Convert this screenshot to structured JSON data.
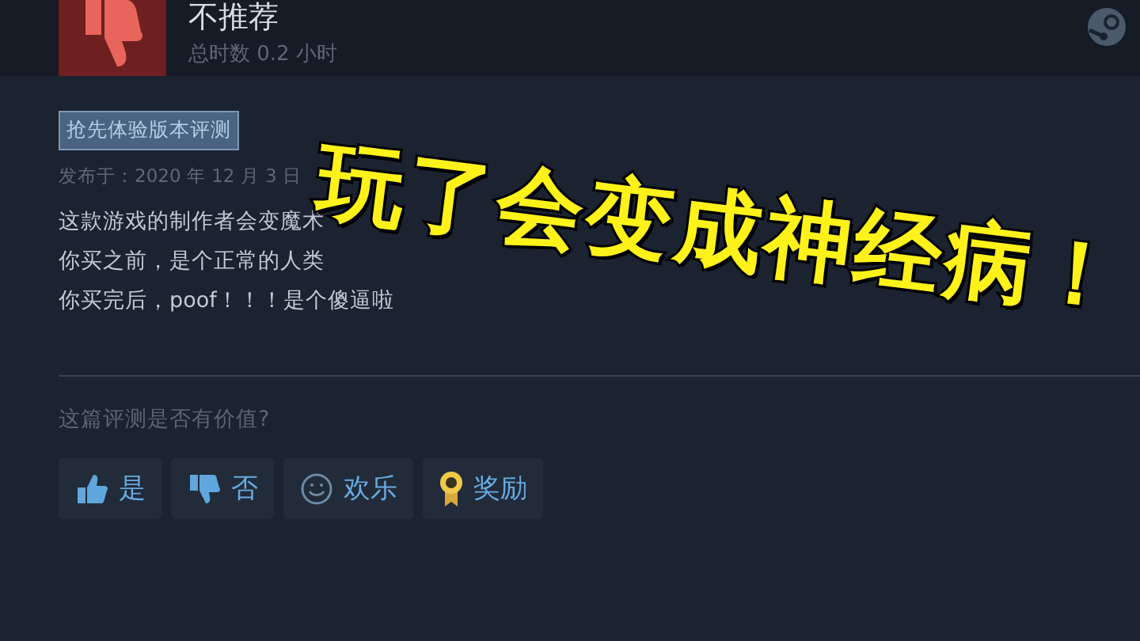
{
  "review": {
    "verdict": "不推荐",
    "hours": "总时数 0.2 小时",
    "badge": "抢先体验版本评测",
    "date": "发布于：2020 年 12 月 3 日",
    "lines": [
      "这款游戏的制作者会变魔术",
      "你买之前，是个正常的人类",
      "你买完后，poof！！！是个傻逼啦"
    ]
  },
  "caption": "玩了会变成神经病！",
  "helpful": {
    "question": "这篇评测是否有价值?",
    "buttons": [
      {
        "kind": "up",
        "label": "是"
      },
      {
        "kind": "down",
        "label": "否"
      },
      {
        "kind": "smile",
        "label": "欢乐"
      },
      {
        "kind": "award",
        "label": "奖励"
      }
    ]
  }
}
